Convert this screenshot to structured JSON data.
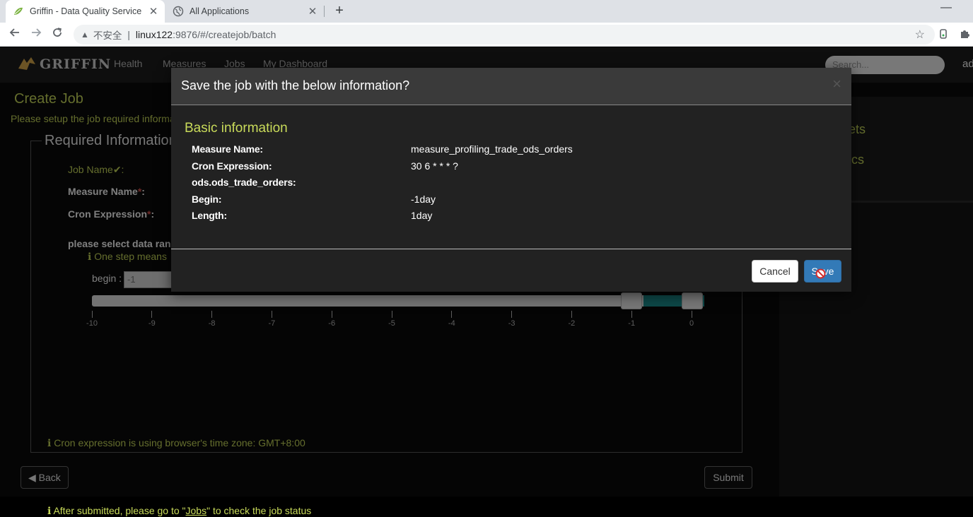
{
  "browser": {
    "tabs": [
      {
        "title": "Griffin - Data Quality Service",
        "active": true
      },
      {
        "title": "All Applications",
        "active": false
      }
    ],
    "new_tab": "+",
    "minimize": "—",
    "address": {
      "insecure_label": "不安全",
      "separator": "|",
      "host": "linux122",
      "path": ":9876/#/createjob/batch"
    }
  },
  "app": {
    "logo_text": "GRIFFIN",
    "nav": [
      "Health",
      "Measures",
      "Jobs",
      "My Dashboard"
    ],
    "search_placeholder": "Search...",
    "user": "ad"
  },
  "page": {
    "title": "Create Job",
    "setup_hint": "Please setup the job required information",
    "legend": "Required Information",
    "job_name_label": "Job Name",
    "check": "✔",
    "colon": ":",
    "measure_name_label": "Measure Name",
    "cron_label": "Cron Expression",
    "required_mark": "*",
    "range_label": "please select data range",
    "step_hint": "One step means",
    "begin_label": "begin :",
    "begin_value": "-1",
    "ticks": [
      "-10",
      "-9",
      "-8",
      "-7",
      "-6",
      "-5",
      "-4",
      "-3",
      "-2",
      "-1",
      "0"
    ],
    "foot_hint_1_prefix": "After submitted, please go to \"",
    "foot_hint_1_link": "Jobs",
    "foot_hint_1_suffix": "\" to check the job status",
    "foot_hint_2": "Cron expression is using browser's time zone: GMT+8:00",
    "back_label": "Back",
    "submit_label": "Submit",
    "side_links": [
      "ets",
      "ics"
    ]
  },
  "modal": {
    "title": "Save the job with the below information?",
    "close": "×",
    "section_title": "Basic information",
    "rows": [
      {
        "key": "Measure Name:",
        "value": "measure_profiling_trade_ods_orders"
      },
      {
        "key": "Cron Expression:",
        "value": "30 6 * * * ?"
      },
      {
        "key": "ods.ods_trade_orders:",
        "value": ""
      },
      {
        "key": "Begin:",
        "value": "-1day"
      },
      {
        "key": "Length:",
        "value": "1day"
      }
    ],
    "cancel_label": "Cancel",
    "save_label": "Save"
  },
  "colors": {
    "accent": "#c9db5a",
    "primary_button": "#337ab7",
    "slider_fill": "#1b8f8f"
  },
  "icons": [
    "griffin-favicon",
    "globe-favicon",
    "back-arrow-icon",
    "forward-arrow-icon",
    "reload-icon",
    "warning-icon",
    "star-icon",
    "extension-icon",
    "puzzle-icon",
    "info-icon",
    "arrow-left-circle-icon",
    "not-allowed-cursor-icon"
  ]
}
